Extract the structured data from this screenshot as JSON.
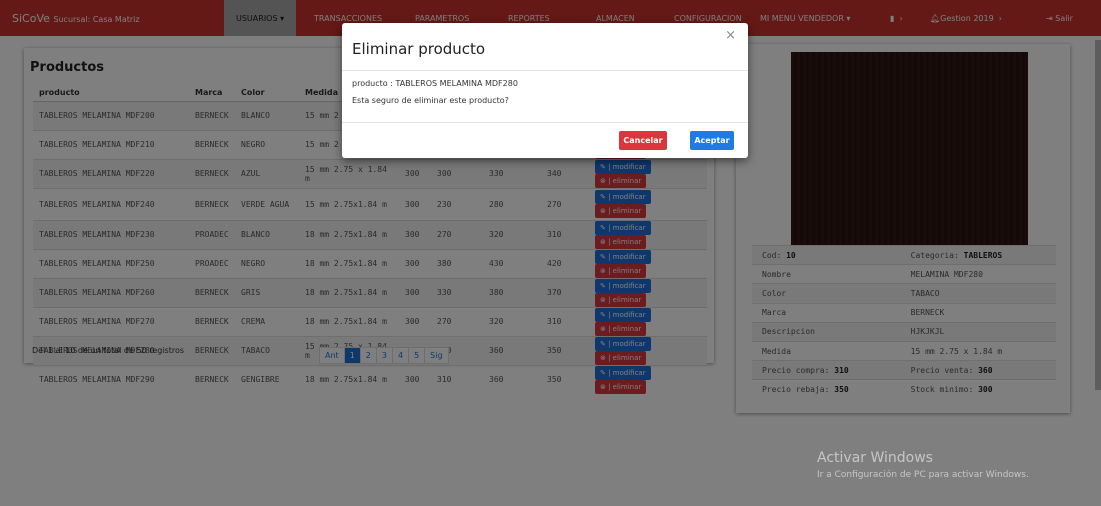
{
  "navbar": {
    "brand": "SiCoVe",
    "branch": "Sucursal: Casa Matriz",
    "usuarios": "USUARIOS ▾",
    "transacciones": "TRANSACCIONES",
    "parametros": "PARAMETROS",
    "reportes": "REPORTES",
    "almacen": "ALMACEN",
    "configuracion": "CONFIGURACION",
    "vendedor_menu": "MI MENU VENDEDOR ▾",
    "gestion": "Gestion 2019",
    "salir": "Salir"
  },
  "products": {
    "title": "Productos",
    "headers": [
      "producto",
      "Marca",
      "Color",
      "Medida",
      "",
      "",
      "",
      ""
    ],
    "rows": [
      [
        "TABLEROS MELAMINA MDF200",
        "BERNECK",
        "BLANCO",
        "15 mm 2",
        "",
        "",
        "",
        ""
      ],
      [
        "TABLEROS MELAMINA MDF210",
        "BERNECK",
        "NEGRO",
        "15 mm 2",
        "",
        "",
        "",
        ""
      ],
      [
        "TABLEROS MELAMINA MDF220",
        "BERNECK",
        "AZUL",
        "15 mm 2.75 x 1.84 m",
        "300",
        "300",
        "330",
        "340"
      ],
      [
        "TABLEROS MELAMINA MDF240",
        "BERNECK",
        "VERDE AGUA",
        "15 mm 2.75x1.84 m",
        "300",
        "230",
        "280",
        "270"
      ],
      [
        "TABLEROS MELAMINA MDF230",
        "PROADEC",
        "BLANCO",
        "18 mm 2.75x1.84 m",
        "300",
        "270",
        "320",
        "310"
      ],
      [
        "TABLEROS MELAMINA MDF250",
        "PROADEC",
        "NEGRO",
        "18 mm 2.75x1.84 m",
        "300",
        "380",
        "430",
        "420"
      ],
      [
        "TABLEROS MELAMINA MDF260",
        "BERNECK",
        "GRIS",
        "18 mm 2.75x1.84 m",
        "300",
        "330",
        "380",
        "370"
      ],
      [
        "TABLEROS MELAMINA MDF270",
        "BERNECK",
        "CREMA",
        "18 mm 2.75x1.84 m",
        "300",
        "270",
        "320",
        "310"
      ],
      [
        "TABLEROS MELAMINA MDF280",
        "BERNECK",
        "TABACO",
        "15 mm 2.75 x 1.84 m",
        "300",
        "310",
        "360",
        "350"
      ],
      [
        "TABLEROS MELAMINA MDF290",
        "BERNECK",
        "GENGIBRE",
        "18 mm 2.75x1.84 m",
        "300",
        "310",
        "360",
        "350"
      ]
    ],
    "modify_label": "✎ | modificar",
    "delete_label": "⊗ | eliminar",
    "records_info": "Del 1 al 10 de un total de 50 registros",
    "pages": [
      "Ant",
      "1",
      "2",
      "3",
      "4",
      "5",
      "Sig"
    ]
  },
  "detail": {
    "cod_label": "Cod:",
    "cod": "10",
    "categoria_label": "Categoria:",
    "categoria": "TABLEROS",
    "nombre_label": "Nombre",
    "nombre": "MELAMINA MDF280",
    "color_label": "Color",
    "color": "TABACO",
    "marca_label": "Marca",
    "marca": "BERNECK",
    "descripcion_label": "Descripcion",
    "descripcion": "HJKJKJL",
    "medida_label": "Medida",
    "medida": "15 mm 2.75 x 1.84 m",
    "precio_compra_label": "Precio compra:",
    "precio_compra": "310",
    "precio_venta_label": "Precio venta:",
    "precio_venta": "360",
    "precio_rebaja_label": "Precio rebaja:",
    "precio_rebaja": "350",
    "stock_label": "Stock minimo:",
    "stock": "300"
  },
  "modal": {
    "title": "Eliminar producto",
    "close": "×",
    "line1": "producto : TABLEROS MELAMINA MDF280",
    "line2": "Esta seguro de eliminar este producto?",
    "cancel": "Cancelar",
    "accept": "Aceptar"
  },
  "watermark": {
    "line1": "Activar Windows",
    "line2": "Ir a Configuración de PC para activar Windows."
  },
  "colors": {
    "navbar": "#c8322d",
    "primary": "#1e6fd9",
    "danger": "#d9363e"
  }
}
